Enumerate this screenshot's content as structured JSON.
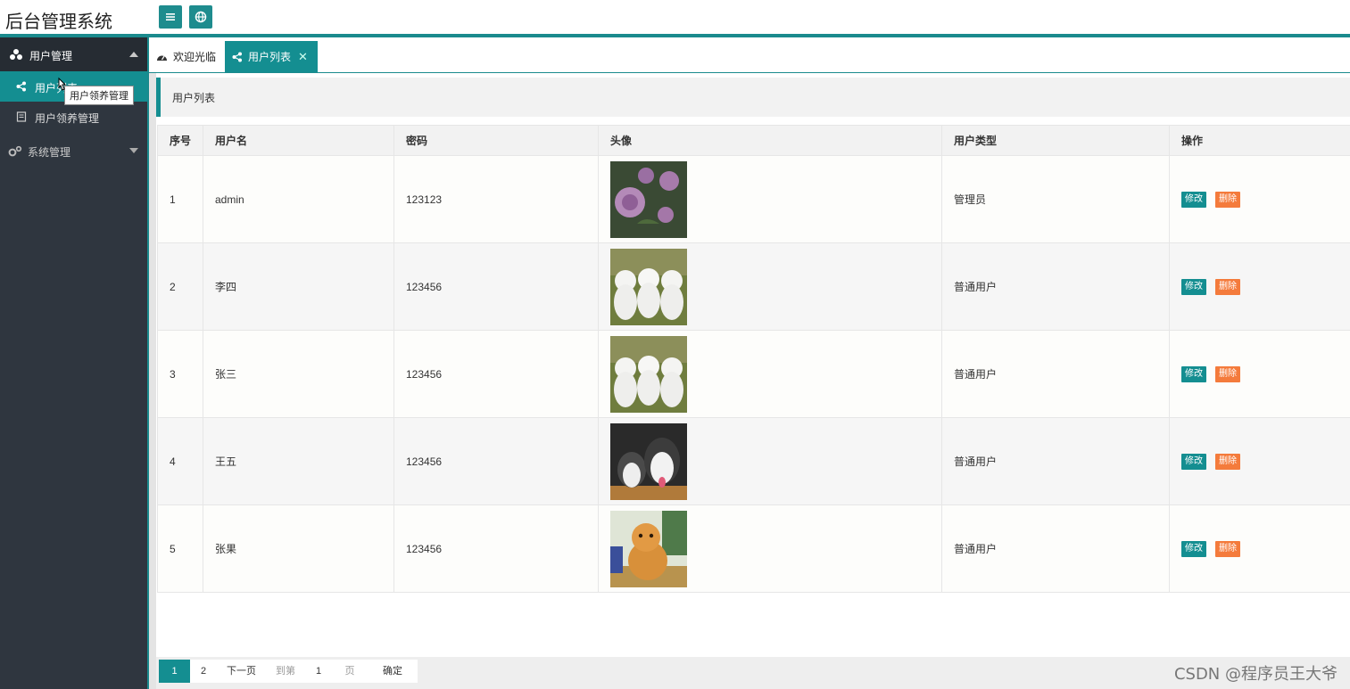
{
  "app": {
    "title": "后台管理系统"
  },
  "header": {
    "menu_icon": "hamburger-icon",
    "globe_icon": "globe-icon"
  },
  "sidebar": {
    "groups": [
      {
        "label": "用户管理",
        "icon": "cubes-icon",
        "expanded": true,
        "items": [
          {
            "label": "用户列表",
            "icon": "share-icon",
            "active": true
          },
          {
            "label": "用户领养管理",
            "icon": "document-icon",
            "active": false
          }
        ]
      },
      {
        "label": "系统管理",
        "icon": "gears-icon",
        "expanded": false
      }
    ],
    "tooltip": "用户领养管理"
  },
  "tabs": [
    {
      "label": "欢迎光临",
      "icon": "dashboard-icon",
      "active": false
    },
    {
      "label": "用户列表",
      "icon": "share-icon",
      "active": true,
      "close": "✕"
    }
  ],
  "page": {
    "title": "用户列表"
  },
  "table": {
    "columns": [
      "序号",
      "用户名",
      "密码",
      "头像",
      "用户类型",
      "操作"
    ],
    "rows": [
      {
        "id": "1",
        "username": "admin",
        "password": "123123",
        "avatar": "rose",
        "type": "管理员"
      },
      {
        "id": "2",
        "username": "李四",
        "password": "123456",
        "avatar": "white-dogs",
        "type": "普通用户"
      },
      {
        "id": "3",
        "username": "张三",
        "password": "123456",
        "avatar": "white-dogs",
        "type": "普通用户"
      },
      {
        "id": "4",
        "username": "王五",
        "password": "123456",
        "avatar": "husky",
        "type": "普通用户"
      },
      {
        "id": "5",
        "username": "张果",
        "password": "123456",
        "avatar": "cat",
        "type": "普通用户"
      }
    ],
    "edit_label": "修改",
    "delete_label": "删除"
  },
  "pager": {
    "pages": [
      "1",
      "2"
    ],
    "current": "1",
    "next_label": "下一页",
    "goto_label": "到第",
    "goto_value": "1",
    "unit_label": "页",
    "confirm_label": "确定"
  },
  "watermark": "CSDN @程序员王大爷",
  "colors": {
    "accent": "#148e91",
    "danger": "#f47b3c",
    "sidebar": "#2f363f"
  }
}
